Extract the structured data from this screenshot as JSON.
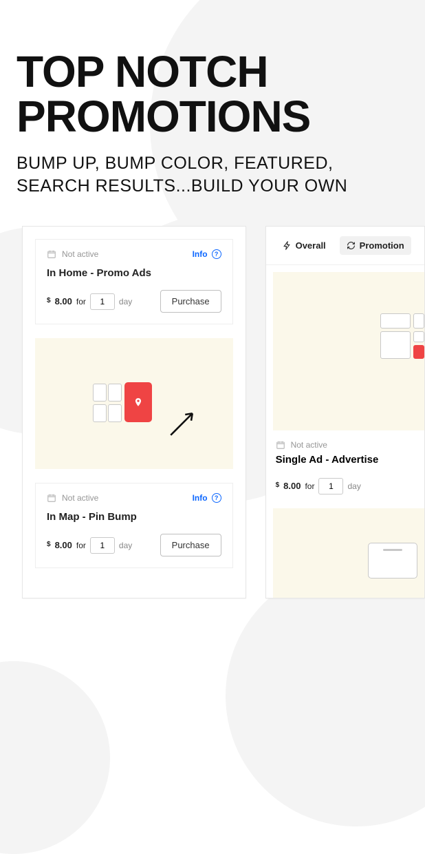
{
  "hero": {
    "title_line1": "TOP NOTCH",
    "title_line2": "PROMOTIONS",
    "subtitle_line1": "BUMP UP, BUMP COLOR, FEATURED,",
    "subtitle_line2": "SEARCH RESULTS...BUILD YOUR OWN"
  },
  "common": {
    "not_active": "Not active",
    "info": "Info",
    "purchase": "Purchase",
    "for": "for",
    "day": "day",
    "currency": "$"
  },
  "panelA": {
    "card1": {
      "title": "In Home - Promo Ads",
      "price": "8.00",
      "qty": "1"
    },
    "card2": {
      "title": "In Map - Pin Bump",
      "price": "8.00",
      "qty": "1"
    }
  },
  "panelB": {
    "tabs": {
      "overall": "Overall",
      "promotions": "Promotion"
    },
    "card": {
      "title": "Single Ad - Advertise",
      "price": "8.00",
      "qty": "1"
    }
  }
}
